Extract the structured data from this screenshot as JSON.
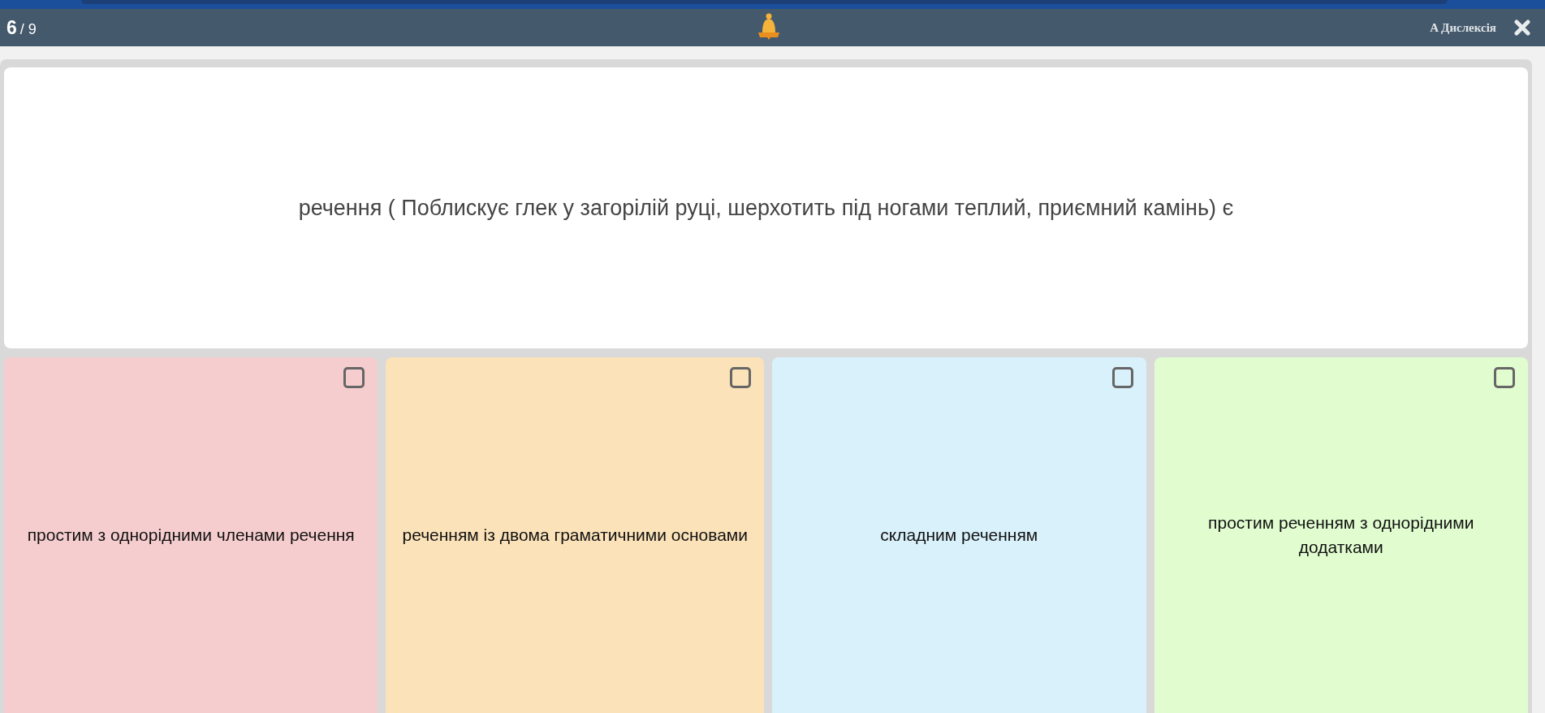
{
  "header": {
    "current": "6",
    "total": "/ 9",
    "dyslexia_label": "A Дислексія"
  },
  "question": {
    "text": "речення ( Поблискує глек у загорілій руці, шерхотить під ногами теплий, приємний камінь) є"
  },
  "options": [
    {
      "text": "простим з однорідними членами речення",
      "color": "#f6cdce",
      "checked": false
    },
    {
      "text": "реченням із двома граматичними основами",
      "color": "#fbe2b9",
      "checked": false
    },
    {
      "text": "складним реченням",
      "color": "#d9f1fb",
      "checked": false
    },
    {
      "text": "простим реченням з однорідними додатками",
      "color": "#e1fdd0",
      "checked": false
    }
  ]
}
